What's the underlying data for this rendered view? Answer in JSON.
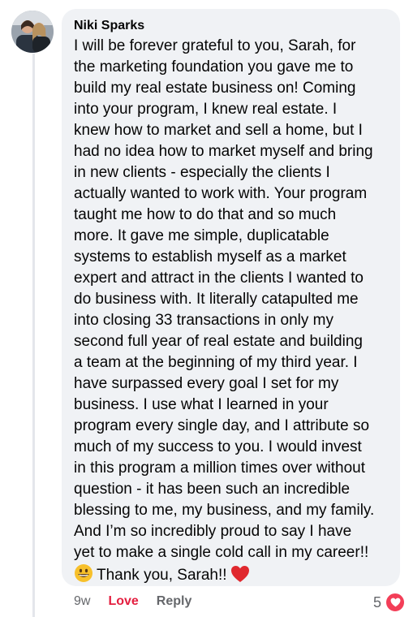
{
  "comment": {
    "author": "Niki Sparks",
    "lines": [
      "I will be forever grateful to you, Sarah, for",
      "the marketing foundation you gave me to",
      "build my real estate business on! Coming",
      "into your program, I knew real estate. I",
      "knew how to market and sell a home, but I",
      "had no idea how to market myself and bring",
      "in new clients - especially the clients I",
      "actually wanted to work with. Your program",
      "taught me how to do that and so much",
      "more. It gave me simple, duplicatable",
      "systems to establish myself as a market",
      "expert and attract in the clients I wanted to",
      "do business with. It literally catapulted me",
      "into closing 33 transactions in only my",
      "second full year of real estate and building",
      "a team at the beginning of my third year. I",
      "have surpassed every goal I set for my",
      "business. I use what I learned in your",
      "program every single day, and I attribute so",
      "much of my success to you. I would invest",
      "in this program a million times over without",
      "question - it has been such an incredible",
      "blessing to me, my business, and my family.",
      "And I’m so incredibly proud to say I have",
      "yet to make a single cold call in my career!!"
    ],
    "last_line": "Thank you, Sarah!!",
    "leading_emoji": "grinning-face-emoji",
    "trailing_emoji": "red-heart-emoji"
  },
  "actions": {
    "time": "9w",
    "love_label": "Love",
    "reply_label": "Reply"
  },
  "reactions": {
    "count": "5",
    "icon": "love-reaction-icon",
    "color": "#f33e58"
  },
  "colors": {
    "bubble": "#f0f2f5",
    "love_text": "#e41e3f",
    "meta_text": "#65676b"
  }
}
